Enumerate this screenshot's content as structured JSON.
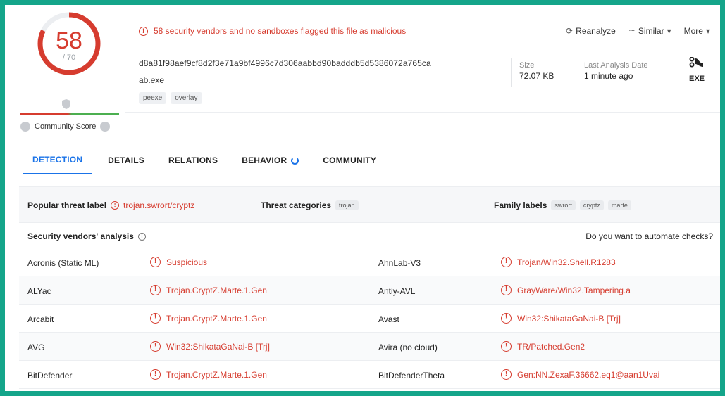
{
  "score": {
    "detections": "58",
    "total": "/ 70",
    "community_label": "Community Score"
  },
  "alert": {
    "text": "58 security vendors and no sandboxes flagged this file as malicious"
  },
  "file": {
    "hash": "d8a81f98aef9cf8d2f3e71a9bf4996c7d306aabbd90badddb5d5386072a765ca",
    "name": "ab.exe",
    "tags": [
      "peexe",
      "overlay"
    ],
    "size_label": "Size",
    "size_value": "72.07 KB",
    "date_label": "Last Analysis Date",
    "date_value": "1 minute ago",
    "type": "EXE"
  },
  "actions": {
    "reanalyze": "Reanalyze",
    "similar": "Similar",
    "more": "More"
  },
  "tabs": [
    "DETECTION",
    "DETAILS",
    "RELATIONS",
    "BEHAVIOR",
    "COMMUNITY"
  ],
  "summary": {
    "popular_label": "Popular threat label",
    "popular_value": "trojan.swrort/cryptz",
    "categories_label": "Threat categories",
    "categories": [
      "trojan"
    ],
    "family_label": "Family labels",
    "families": [
      "swrort",
      "cryptz",
      "marte"
    ]
  },
  "vendors": {
    "title": "Security vendors' analysis",
    "automate": "Do you want to automate checks?",
    "rows": [
      {
        "left_name": "Acronis (Static ML)",
        "left_result": "Suspicious",
        "right_name": "AhnLab-V3",
        "right_result": "Trojan/Win32.Shell.R1283"
      },
      {
        "left_name": "ALYac",
        "left_result": "Trojan.CryptZ.Marte.1.Gen",
        "right_name": "Antiy-AVL",
        "right_result": "GrayWare/Win32.Tampering.a"
      },
      {
        "left_name": "Arcabit",
        "left_result": "Trojan.CryptZ.Marte.1.Gen",
        "right_name": "Avast",
        "right_result": "Win32:ShikataGaNai-B [Trj]"
      },
      {
        "left_name": "AVG",
        "left_result": "Win32:ShikataGaNai-B [Trj]",
        "right_name": "Avira (no cloud)",
        "right_result": "TR/Patched.Gen2"
      },
      {
        "left_name": "BitDefender",
        "left_result": "Trojan.CryptZ.Marte.1.Gen",
        "right_name": "BitDefenderTheta",
        "right_result": "Gen:NN.ZexaF.36662.eq1@aan1Uvai"
      }
    ]
  },
  "colors": {
    "accent": "#1a73e8",
    "danger": "#d63c2f",
    "frame": "#14a58a"
  }
}
